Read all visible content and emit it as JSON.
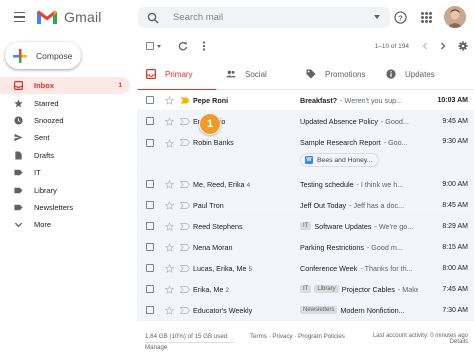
{
  "app": {
    "name": "Gmail",
    "brand_colors": {
      "red": "#EA4335",
      "blue": "#4285F4",
      "green": "#34A853",
      "yellow": "#FBBC04",
      "accent": "#D93025"
    }
  },
  "search": {
    "placeholder": "Search mail"
  },
  "compose": {
    "label": "Compose"
  },
  "sidebar": {
    "items": [
      {
        "label": "Inbox",
        "count": "1",
        "icon": "inbox-icon"
      },
      {
        "label": "Starred",
        "icon": "star-icon"
      },
      {
        "label": "Snoozed",
        "icon": "clock-icon"
      },
      {
        "label": "Sent",
        "icon": "send-icon"
      },
      {
        "label": "Drafts",
        "icon": "draft-icon"
      },
      {
        "label": "IT",
        "icon": "label-icon"
      },
      {
        "label": "Library",
        "icon": "label-icon"
      },
      {
        "label": "Newsletters",
        "icon": "label-icon"
      },
      {
        "label": "More",
        "icon": "chevron-down-icon"
      }
    ]
  },
  "toolbar": {
    "pager": "1–10 of 194"
  },
  "tabs": [
    {
      "label": "Primary",
      "icon": "inbox-icon"
    },
    {
      "label": "Social",
      "icon": "people-icon"
    },
    {
      "label": "Promotions",
      "icon": "tag-icon"
    },
    {
      "label": "Updates",
      "icon": "info-icon"
    }
  ],
  "emails": [
    {
      "sender": "Pepe Roni",
      "count": "",
      "labels": [],
      "subject": "Breakfast?",
      "snippet": "- Weren't you sup...",
      "date": "10:03 AM",
      "unread": true
    },
    {
      "sender": "Erin Loujo",
      "count": "",
      "labels": [],
      "subject": "Updated Absence Policy",
      "snippet": "- Good...",
      "date": "9:45 AM",
      "unread": false
    },
    {
      "sender": "Robin Banks",
      "count": "",
      "labels": [],
      "subject": "Sample Research Report",
      "snippet": "- Goo...",
      "date": "9:30 AM",
      "unread": false,
      "attachment": "Bees and Honey..."
    },
    {
      "sender": "Me, Reed, Erika",
      "count": "4",
      "labels": [],
      "subject": "Testing schedule",
      "snippet": "- I think we h...",
      "date": "9:00 AM",
      "unread": false
    },
    {
      "sender": "Paul Tron",
      "count": "",
      "labels": [],
      "subject": "Jeff Out Today",
      "snippet": "- Jeff has a doc...",
      "date": "8:45 AM",
      "unread": false
    },
    {
      "sender": "Reed Stephens",
      "count": "",
      "labels": [
        "IT"
      ],
      "subject": "Software Updates",
      "snippet": "- We're go...",
      "date": "8:29 AM",
      "unread": false
    },
    {
      "sender": "Nena Moran",
      "count": "",
      "labels": [],
      "subject": "Parking Restrictions",
      "snippet": "- Good m...",
      "date": "8:15 AM",
      "unread": false
    },
    {
      "sender": "Lucas, Erika, Me",
      "count": "5",
      "labels": [],
      "subject": "Conference Week",
      "snippet": "- Thanks for th...",
      "date": "8:00 AM",
      "unread": false
    },
    {
      "sender": "Erika, Me",
      "count": "2",
      "labels": [
        "IT",
        "Library"
      ],
      "subject": "Projector Cables",
      "snippet": "- Make...",
      "date": "7:45 AM",
      "unread": false
    },
    {
      "sender": "Educator's Weekly",
      "count": "",
      "labels": [
        "Newsletters"
      ],
      "subject": "Modern Nonfiction...",
      "snippet": "",
      "date": "7:30 AM",
      "unread": false
    }
  ],
  "footer": {
    "storage": "1.64 GB (10%) of 15 GB used",
    "manage": "Manage",
    "terms": "Terms · Privacy · Program Policies",
    "activity_line1": "Last account activity: 0 minutes ago",
    "activity_line2": "Details"
  },
  "callout": {
    "number": "1",
    "color": "#F09A2C"
  }
}
